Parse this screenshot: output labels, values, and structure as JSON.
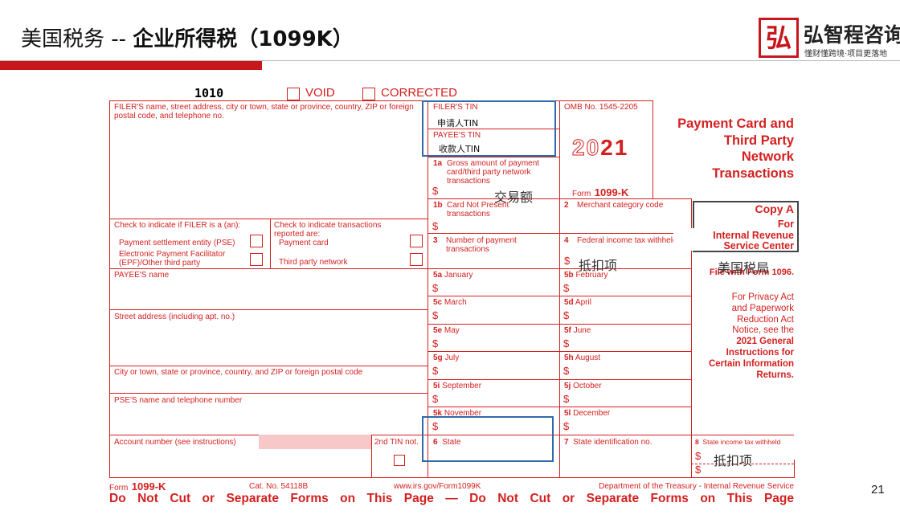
{
  "header": {
    "title_prefix": "美国税务 -- ",
    "title_bold": "企业所得税（1099K）",
    "logo_name": "弘智程咨询",
    "logo_tagline": "懂财懂跨境·项目更落地",
    "logo_mark": "弘"
  },
  "page_number": "21",
  "form": {
    "top_code": "1010",
    "void_label": "VOID",
    "corrected_label": "CORRECTED",
    "filer_block": "FILER'S name, street address, city or town, state or province, country, ZIP or foreign postal code, and telephone no.",
    "filer_tin": "FILER'S TIN",
    "payee_tin": "PAYEE'S TIN",
    "omb": "OMB No. 1545-2205",
    "year_outline": "20",
    "year_solid": "21",
    "form_label_small": "Form",
    "form_label_big": "1099-K",
    "form_title": [
      "Payment Card and",
      "Third Party",
      "Network",
      "Transactions"
    ],
    "box1a_num": "1a",
    "box1a_text": "Gross amount of payment card/third party network transactions",
    "box1b_num": "1b",
    "box1b_text": "Card Not Present transactions",
    "box2_num": "2",
    "box2_text": "Merchant category code",
    "box3_num": "3",
    "box3_text": "Number of payment transactions",
    "box4_num": "4",
    "box4_text": "Federal income tax withheld",
    "dollar": "$",
    "check_filer": "Check to indicate if FILER is a (an):",
    "pse": "Payment settlement entity (PSE)",
    "epf": "Electronic Payment Facilitator (EPF)/Other third party",
    "check_trans": "Check to indicate transactions reported are:",
    "payment_card": "Payment card",
    "third_party": "Third party network",
    "copy_a": "Copy A",
    "copy_for": "For",
    "copy_irs1": "Internal Revenue",
    "copy_irs2": "Service Center",
    "file_with": "File with Form 1096.",
    "privacy": [
      "For Privacy Act",
      "and Paperwork",
      "Reduction Act",
      "Notice, see the"
    ],
    "privacy_bold": [
      "2021 General",
      "Instructions for",
      "Certain Information",
      "Returns."
    ],
    "payee_name": "PAYEE'S name",
    "street": "Street address (including apt. no.)",
    "city": "City or town, state or province, country, and ZIP or foreign postal code",
    "pse_name": "PSE'S name and telephone number",
    "account": "Account number (see instructions)",
    "second_tin": "2nd TIN not.",
    "months": [
      {
        "num": "5a",
        "name": "January"
      },
      {
        "num": "5b",
        "name": "February"
      },
      {
        "num": "5c",
        "name": "March"
      },
      {
        "num": "5d",
        "name": "April"
      },
      {
        "num": "5e",
        "name": "May"
      },
      {
        "num": "5f",
        "name": "June"
      },
      {
        "num": "5g",
        "name": "July"
      },
      {
        "num": "5h",
        "name": "August"
      },
      {
        "num": "5i",
        "name": "September"
      },
      {
        "num": "5j",
        "name": "October"
      },
      {
        "num": "5k",
        "name": "November"
      },
      {
        "num": "5l",
        "name": "December"
      }
    ],
    "box6_num": "6",
    "box6_text": "State",
    "box7_num": "7",
    "box7_text": "State identification no.",
    "box8_num": "8",
    "box8_text": "State income tax withheld",
    "footer_form_small": "Form",
    "footer_form_big": "1099-K",
    "cat_no": "Cat. No. 54118B",
    "website": "www.irs.gov/Form1099K",
    "department": "Department of the Treasury - Internal Revenue Service",
    "do_not_cut": "Do Not Cut or Separate Forms on This Page — Do Not Cut or Separate Forms on This Page"
  },
  "annotations": {
    "filer_tin_cn": "申请人TIN",
    "payee_tin_cn": "收款人TIN",
    "gross_cn": "交易额",
    "withheld_cn": "抵扣项",
    "irs_cn": "美国税局",
    "state_withheld_cn": "抵扣项"
  },
  "colors": {
    "form_red": "#d42020",
    "header_bar": "#c8161d",
    "highlight_blue": "#2e6aa8",
    "account_fill": "#f8c8c8"
  }
}
